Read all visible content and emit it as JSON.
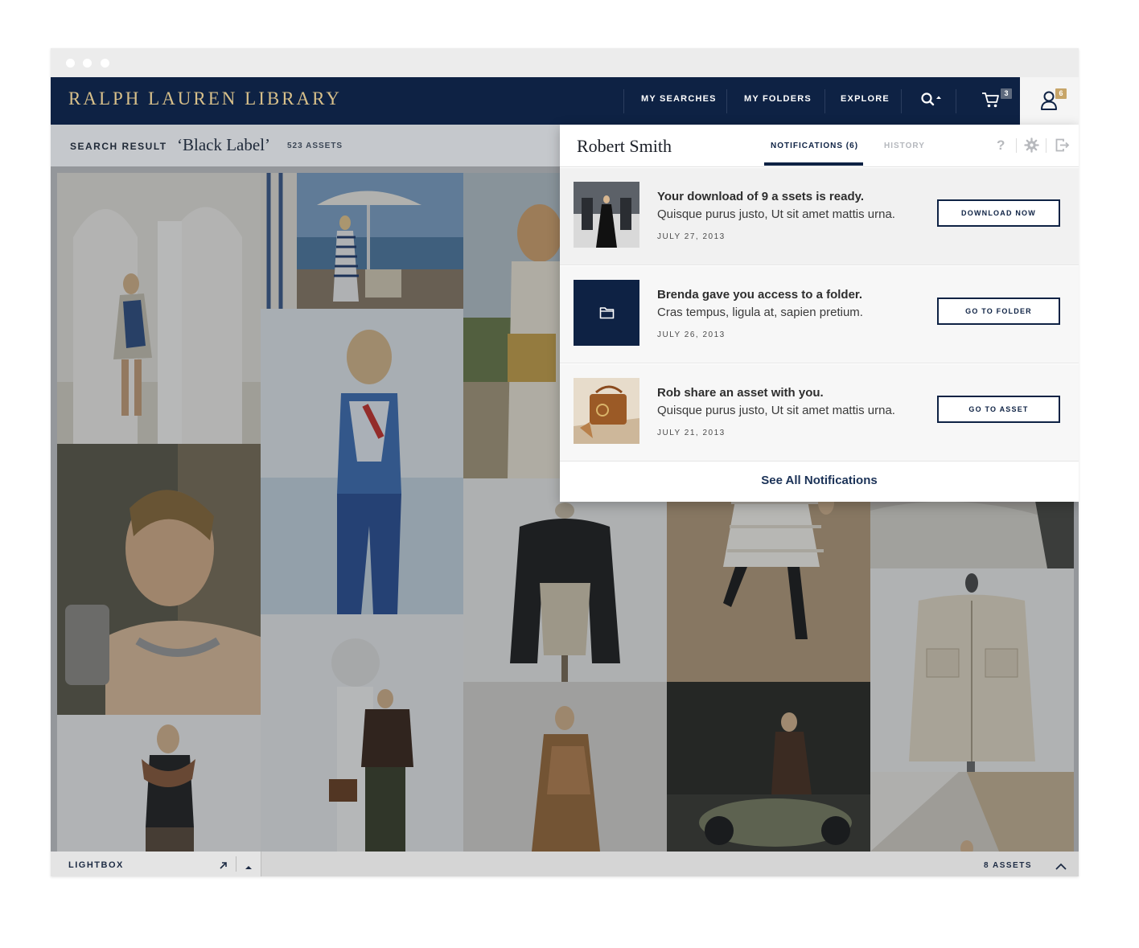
{
  "app": {
    "brand": "RALPH LAUREN LIBRARY"
  },
  "nav": {
    "items": [
      {
        "label": "MY SEARCHES"
      },
      {
        "label": "MY FOLDERS"
      },
      {
        "label": "EXPLORE"
      }
    ],
    "cart_count": "3",
    "notification_count": "6",
    "icons": [
      "search-icon",
      "cart-icon",
      "user-icon"
    ]
  },
  "search": {
    "label": "SEARCH RESULT",
    "query": "‘Black Label’",
    "count": "523 ASSETS"
  },
  "panel": {
    "user_name": "Robert Smith",
    "tabs": [
      {
        "label": "NOTIFICATIONS (6)",
        "active": true
      },
      {
        "label": "HISTORY",
        "active": false
      }
    ],
    "help_label": "?",
    "notifications": [
      {
        "title": "Your download of 9 a ssets is ready.",
        "body": "Quisque purus justo, Ut sit amet mattis urna.",
        "date": "JULY 27, 2013",
        "button": "DOWNLOAD NOW",
        "thumb": "photo"
      },
      {
        "title": "Brenda gave you access to a folder.",
        "body": "Cras tempus, ligula at, sapien pretium.",
        "date": "JULY 26, 2013",
        "button": "GO TO FOLDER",
        "thumb": "folder-icon"
      },
      {
        "title": "Rob share an asset with you.",
        "body": "Quisque purus justo, Ut sit amet mattis urna.",
        "date": "JULY 21, 2013",
        "button": "GO TO ASSET",
        "thumb": "photo"
      }
    ],
    "see_all": "See All Notifications"
  },
  "lightbox": {
    "label": "LIGHTBOX",
    "count": "8 ASSETS"
  },
  "colors": {
    "navy": "#0e2244",
    "gold": "#d8c08a",
    "approve": "#3d8a4a",
    "reject": "#c0263b"
  }
}
